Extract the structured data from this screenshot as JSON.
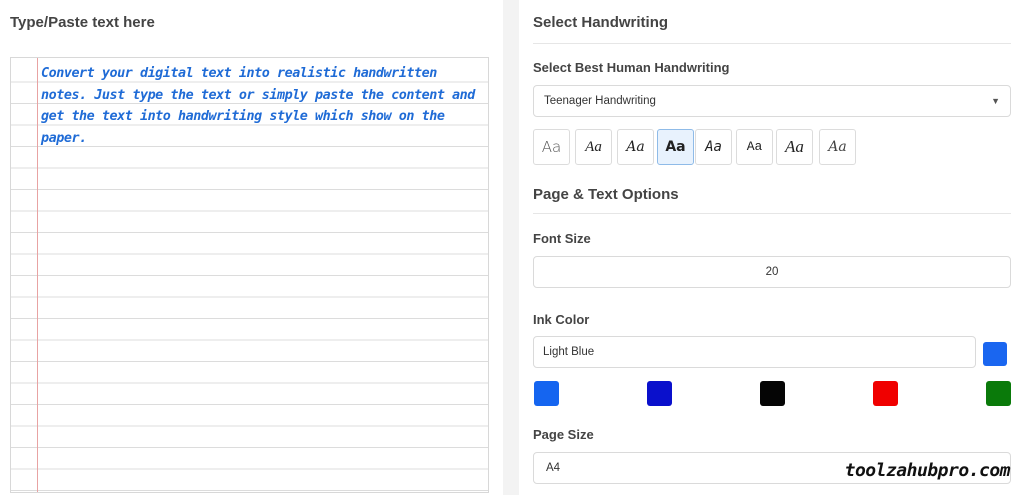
{
  "left": {
    "title": "Type/Paste text here",
    "text": "Convert your digital text into realistic handwritten notes. Just type the text or simply paste the content and get the text into handwriting style which show on the paper."
  },
  "right": {
    "handwriting_title": "Select Handwriting",
    "best_label": "Select Best Human Handwriting",
    "handwriting_selected": "Teenager Handwriting",
    "font_samples": [
      "Aa",
      "Aa",
      "Aa",
      "Aa",
      "Aa",
      "Aa",
      "Aa",
      "Aa"
    ],
    "active_font_index": 3,
    "options_title": "Page & Text Options",
    "font_size_label": "Font Size",
    "font_size_value": "20",
    "ink_color_label": "Ink Color",
    "ink_color_value": "Light Blue",
    "ink_color_hex": "#1a66f0",
    "swatches": [
      "#1565f0",
      "#0a10cc",
      "#050505",
      "#f00000",
      "#0a7a0a"
    ],
    "page_size_label": "Page Size",
    "page_size_value": "A4"
  },
  "watermark": "toolzahubpro.com",
  "colors": {
    "paper_margin": "#e8a3a3",
    "ink": "#1f6bd6"
  }
}
